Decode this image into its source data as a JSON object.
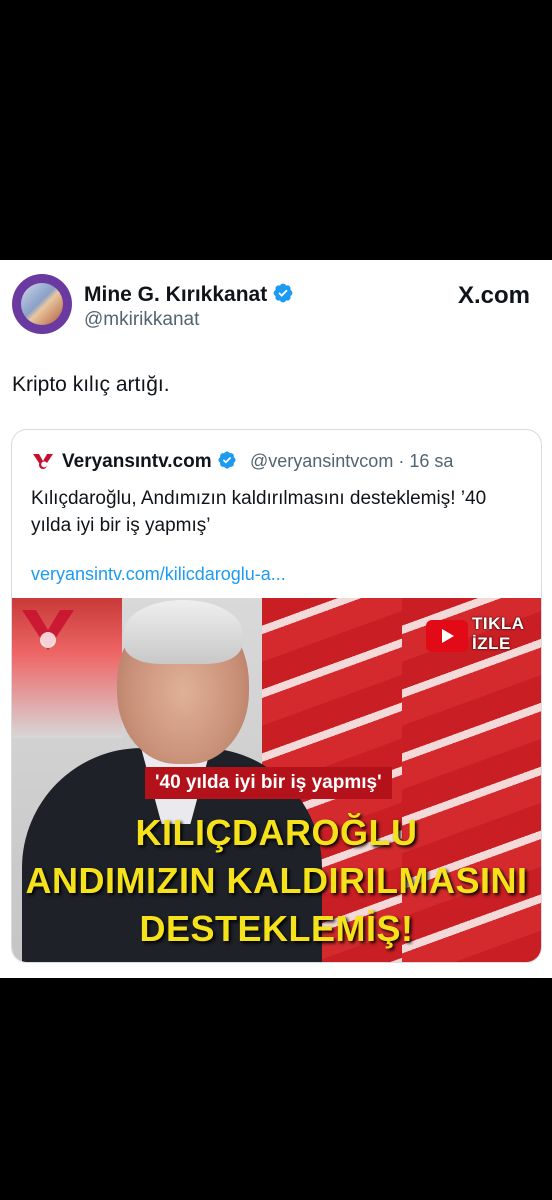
{
  "tweet": {
    "author_name": "Mine G. Kırıkkanat",
    "handle": "@mkirikkanat",
    "platform_logo": "X.com",
    "text": "Kripto kılıç artığı.",
    "avatar": "profile-photo"
  },
  "quoted": {
    "name": "Veryansıntv.com",
    "handle": "@veryansintvcom",
    "separator": "·",
    "time": "16 sa",
    "text": "Kılıçdaroğlu, Andımızın kaldırılmasını desteklemiş! ’40 yılda iyi bir iş yapmış’",
    "link": "veryansintv.com/kilicdaroglu-a...",
    "media": {
      "tikla": "TIKLA",
      "izle": "İZLE",
      "caption": "'40 yılda iyi bir iş yapmış'",
      "headline_lines": [
        "KILIÇDAROĞLU",
        "ANDIMIZIN KALDIRILMASINI",
        "DESTEKLEMİŞ!"
      ]
    }
  },
  "colors": {
    "verified": "#1d9bf0",
    "link": "#1d9bf0",
    "headline": "#f6e21a",
    "caption_bg": "#b4121a",
    "background": "#000000"
  },
  "icons": [
    "verified-badge-icon",
    "x-logo-icon",
    "veryansin-logo-icon",
    "youtube-play-icon"
  ]
}
